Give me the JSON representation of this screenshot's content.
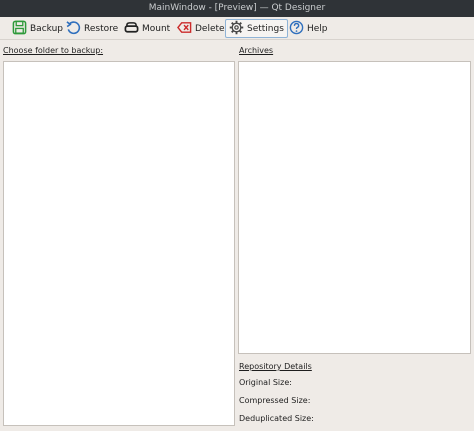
{
  "window": {
    "title": "MainWindow - [Preview] — Qt Designer"
  },
  "toolbar": {
    "backup": {
      "label": "Backup",
      "icon": "save-icon",
      "color": "#2e9a3a"
    },
    "restore": {
      "label": "Restore",
      "icon": "undo-icon",
      "color": "#2f6fbd"
    },
    "mount": {
      "label": "Mount",
      "icon": "drive-icon",
      "color": "#222222"
    },
    "delete": {
      "label": "Delete",
      "icon": "backspace-delete-icon",
      "color": "#cc2b2b"
    },
    "settings": {
      "label": "Settings",
      "icon": "gear-icon",
      "color": "#444444",
      "active": true
    },
    "help": {
      "label": "Help",
      "icon": "question-icon",
      "color": "#2f6fbd"
    }
  },
  "left": {
    "label": "Choose folder to backup:"
  },
  "right": {
    "label": "Archives"
  },
  "details": {
    "heading": "Repository Details",
    "original_size": "Original Size:",
    "compressed_size": "Compressed Size:",
    "deduplicated_size": "Deduplicated Size:"
  },
  "colors": {
    "window_bg": "#efebe7",
    "titlebar_bg": "#2f3337",
    "panel_bg": "#ffffff",
    "active_border": "#8fb3d6"
  }
}
